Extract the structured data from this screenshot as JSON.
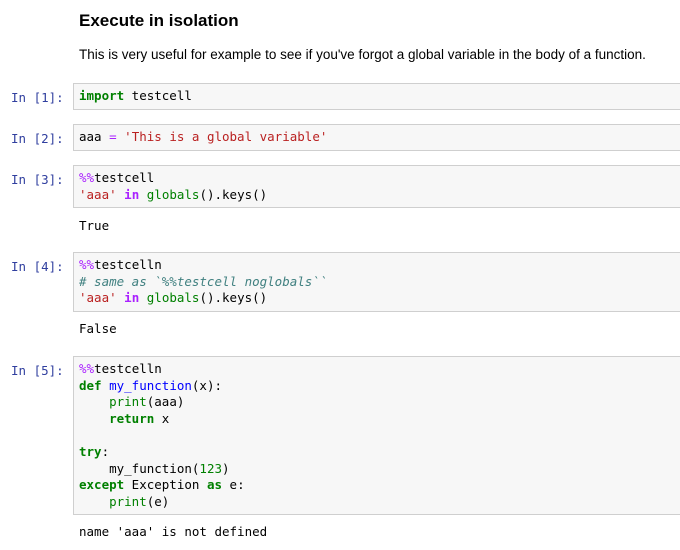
{
  "section": {
    "title": "Execute in isolation",
    "description": "This is very useful for example to see if you've forgot a global variable in the body of a function."
  },
  "cells": [
    {
      "prompt": "In [1]:",
      "lines": [
        [
          {
            "t": "import",
            "c": "kw"
          },
          {
            "t": " testcell",
            "c": ""
          }
        ]
      ],
      "output": ""
    },
    {
      "prompt": "In [2]:",
      "lines": [
        [
          {
            "t": "aaa ",
            "c": ""
          },
          {
            "t": "=",
            "c": "mag"
          },
          {
            "t": " ",
            "c": ""
          },
          {
            "t": "'This is a global variable'",
            "c": "str"
          }
        ]
      ],
      "output": ""
    },
    {
      "prompt": "In [3]:",
      "lines": [
        [
          {
            "t": "%%",
            "c": "mag"
          },
          {
            "t": "testcell",
            "c": ""
          }
        ],
        [
          {
            "t": "'aaa'",
            "c": "str"
          },
          {
            "t": " ",
            "c": ""
          },
          {
            "t": "in",
            "c": "op"
          },
          {
            "t": " ",
            "c": ""
          },
          {
            "t": "globals",
            "c": "bi"
          },
          {
            "t": "().keys()",
            "c": ""
          }
        ]
      ],
      "output": "True"
    },
    {
      "prompt": "In [4]:",
      "lines": [
        [
          {
            "t": "%%",
            "c": "mag"
          },
          {
            "t": "testcelln",
            "c": ""
          }
        ],
        [
          {
            "t": "# same as `%%testcell noglobals``",
            "c": "cmt"
          }
        ],
        [
          {
            "t": "'aaa'",
            "c": "str"
          },
          {
            "t": " ",
            "c": ""
          },
          {
            "t": "in",
            "c": "op"
          },
          {
            "t": " ",
            "c": ""
          },
          {
            "t": "globals",
            "c": "bi"
          },
          {
            "t": "().keys()",
            "c": ""
          }
        ]
      ],
      "output": "False"
    },
    {
      "prompt": "In [5]:",
      "lines": [
        [
          {
            "t": "%%",
            "c": "mag"
          },
          {
            "t": "testcelln",
            "c": ""
          }
        ],
        [
          {
            "t": "def",
            "c": "kw"
          },
          {
            "t": " ",
            "c": ""
          },
          {
            "t": "my_function",
            "c": "fn"
          },
          {
            "t": "(x):",
            "c": ""
          }
        ],
        [
          {
            "t": "    ",
            "c": ""
          },
          {
            "t": "print",
            "c": "bi"
          },
          {
            "t": "(aaa)",
            "c": ""
          }
        ],
        [
          {
            "t": "    ",
            "c": ""
          },
          {
            "t": "return",
            "c": "kw"
          },
          {
            "t": " x",
            "c": ""
          }
        ],
        [],
        [
          {
            "t": "try",
            "c": "kw"
          },
          {
            "t": ":",
            "c": ""
          }
        ],
        [
          {
            "t": "    my_function(",
            "c": ""
          },
          {
            "t": "123",
            "c": "num"
          },
          {
            "t": ")",
            "c": ""
          }
        ],
        [
          {
            "t": "except",
            "c": "kw"
          },
          {
            "t": " Exception ",
            "c": ""
          },
          {
            "t": "as",
            "c": "kw"
          },
          {
            "t": " e:",
            "c": ""
          }
        ],
        [
          {
            "t": "    ",
            "c": ""
          },
          {
            "t": "print",
            "c": "bi"
          },
          {
            "t": "(e)",
            "c": ""
          }
        ]
      ],
      "output": "name 'aaa' is not defined"
    }
  ]
}
